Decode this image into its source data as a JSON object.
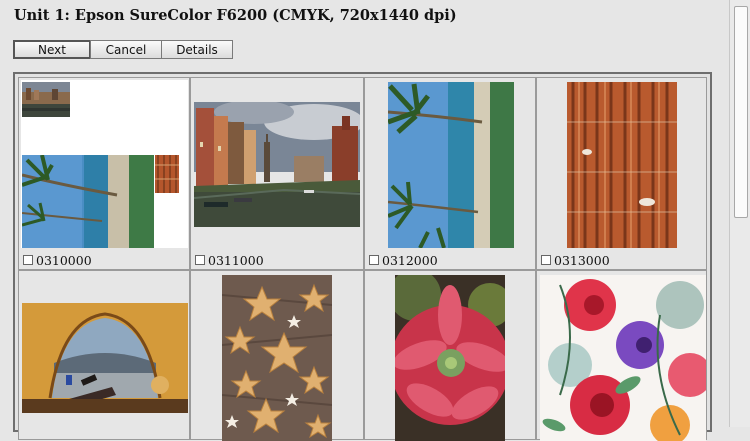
{
  "window": {
    "title": "Unit 1: Epson SureColor F6200 (CMYK, 720x1440 dpi)"
  },
  "toolbar": {
    "next_label": "Next",
    "cancel_label": "Cancel",
    "details_label": "Details"
  },
  "grid": {
    "items": [
      {
        "id": "0310000",
        "checked": false,
        "image": "layout-canal-palms-bark"
      },
      {
        "id": "0311000",
        "checked": false,
        "image": "canal-city"
      },
      {
        "id": "0312000",
        "checked": false,
        "image": "palm-beach"
      },
      {
        "id": "0313000",
        "checked": false,
        "image": "tree-bark"
      },
      {
        "id": "",
        "checked": false,
        "image": "tent-view"
      },
      {
        "id": "",
        "checked": false,
        "image": "star-cookies"
      },
      {
        "id": "",
        "checked": false,
        "image": "red-succulent"
      },
      {
        "id": "",
        "checked": false,
        "image": "watercolor-flowers"
      }
    ]
  },
  "colors": {
    "background": "#e6e6e6",
    "button_border": "#7a7a7a",
    "grid_border": "#6e6e6e"
  }
}
